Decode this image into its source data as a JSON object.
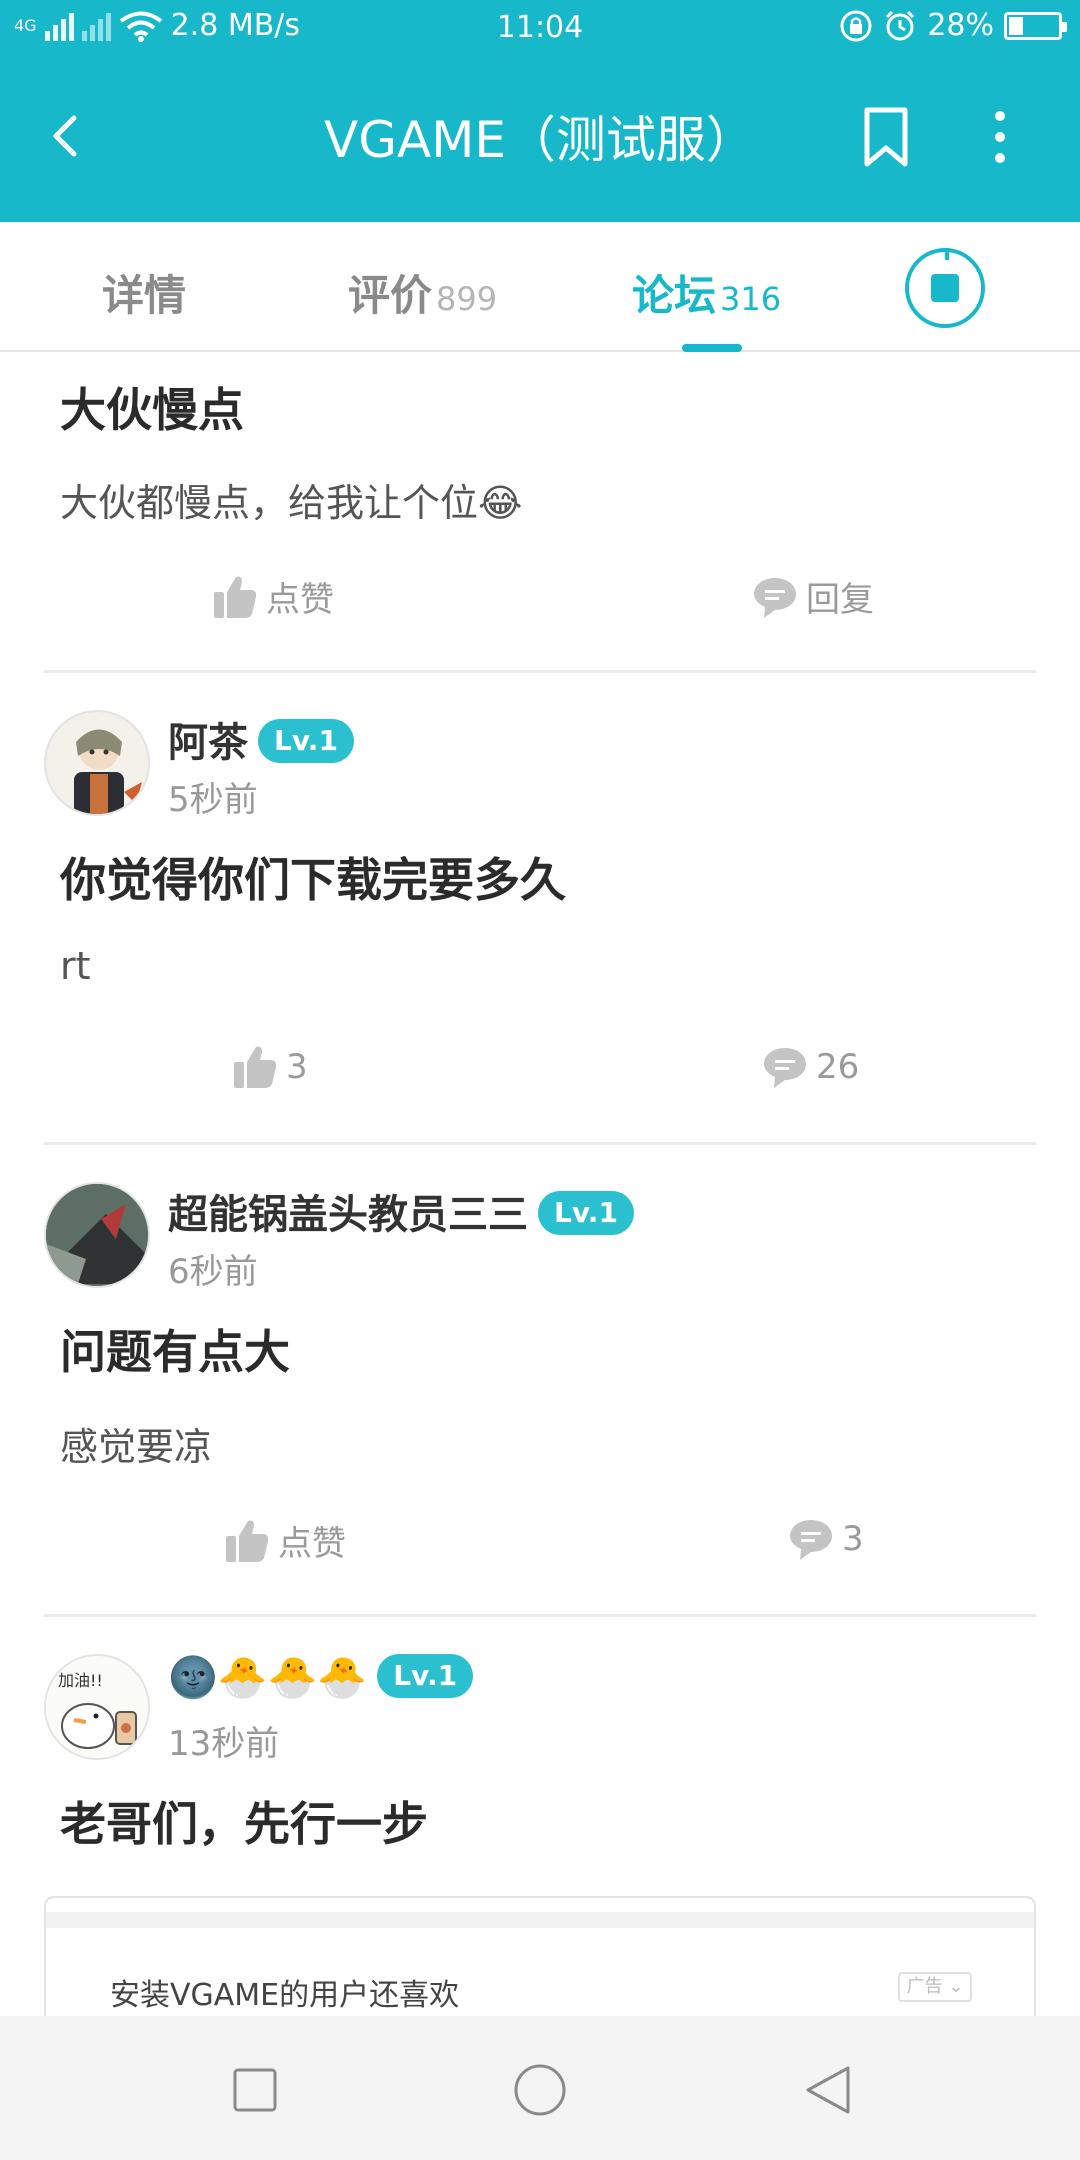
{
  "status_bar": {
    "network_label": "4G",
    "speed": "2.8 MB/s",
    "time": "11:04",
    "battery_percent_label": "28%",
    "battery_level": 0.28
  },
  "app_bar": {
    "title": "VGAME（测试服）",
    "back_icon": "chevron-left-icon",
    "bookmark_icon": "bookmark-icon",
    "more_icon": "more-vertical-icon"
  },
  "tabs": [
    {
      "label": "详情",
      "count": ""
    },
    {
      "label": "评价",
      "count": "899"
    },
    {
      "label": "论坛",
      "count": "316",
      "active": true
    }
  ],
  "posts": [
    {
      "title": "大伙慢点",
      "body": "大伙都慢点，给我让个位😂",
      "like_label": "点赞",
      "reply_label": "回复"
    },
    {
      "username": "阿茶",
      "level": "Lv.1",
      "time": "5秒前",
      "title": "你觉得你们下载完要多久",
      "body": "rt",
      "like_label": "3",
      "reply_label": "26"
    },
    {
      "username": "超能锅盖头教员三三",
      "level": "Lv.1",
      "time": "6秒前",
      "title": "问题有点大",
      "body": "感觉要凉",
      "like_label": "点赞",
      "reply_label": "3"
    },
    {
      "username": "🌚🐣🐣🐣",
      "level": "Lv.1",
      "time": "13秒前",
      "title": "老哥们，先行一步"
    }
  ],
  "ad": {
    "text": "安装VGAME的用户还喜欢",
    "tag": "广告"
  },
  "colors": {
    "accent": "#17b8c9",
    "text": "#333333",
    "muted": "#9a9a9a"
  }
}
